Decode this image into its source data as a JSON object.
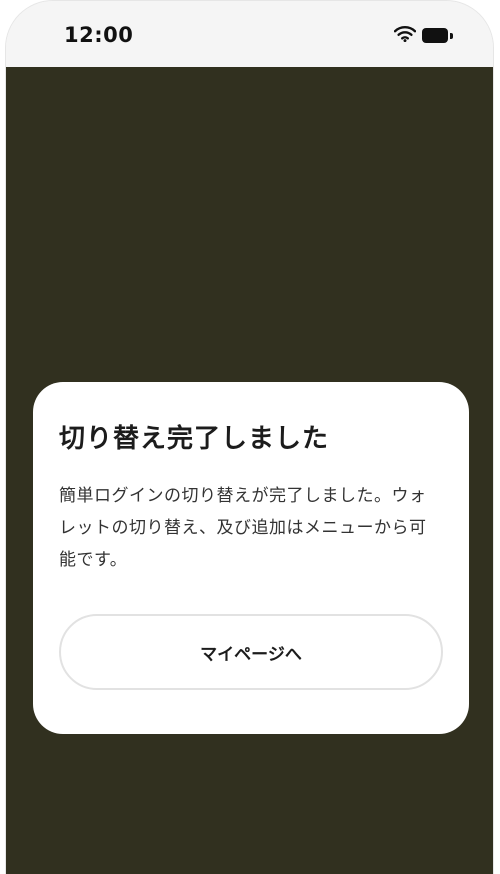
{
  "status_bar": {
    "time": "12:00",
    "icons": [
      "wifi-icon",
      "battery-icon"
    ]
  },
  "dialog": {
    "title": "切り替え完了しました",
    "message": "簡単ログインの切り替えが完了しました。ウォレットの切り替え、及び追加はメニューから可能です。",
    "button_label": "マイページへ"
  },
  "colors": {
    "overlay": "#31301f",
    "dialog_background": "#ffffff",
    "button_border": "#e2e2e2",
    "text": "#1c1c1c"
  }
}
